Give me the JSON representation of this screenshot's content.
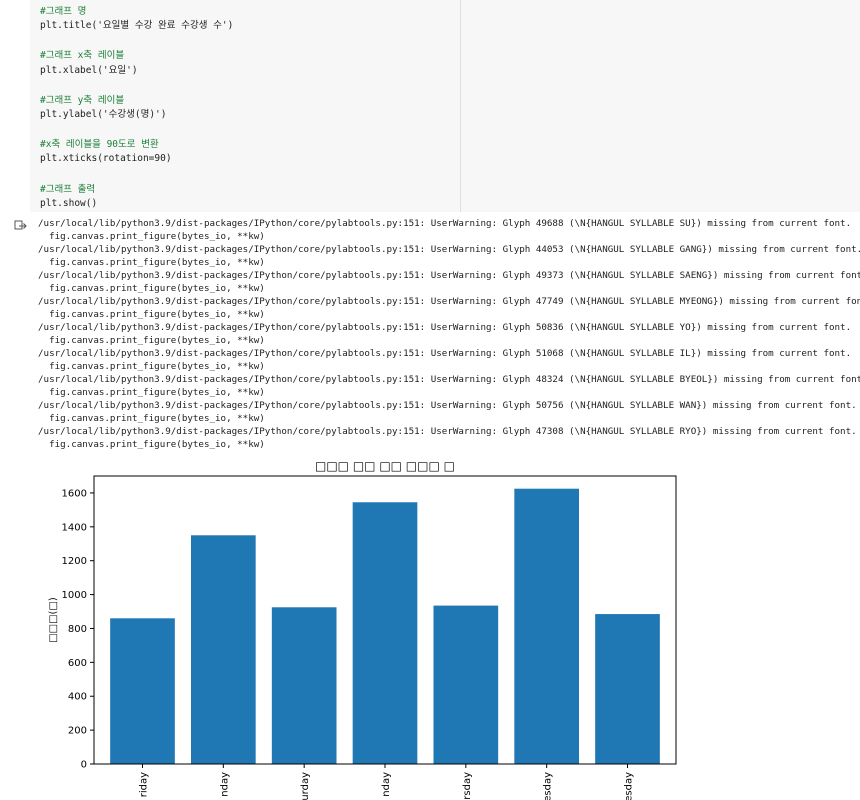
{
  "code_cell": {
    "lines": [
      {
        "kind": "comment",
        "text": "#그래프 명"
      },
      {
        "kind": "code",
        "text": "plt.title('요일별 수강 완료 수강생 수')"
      },
      {
        "kind": "blank",
        "text": ""
      },
      {
        "kind": "comment",
        "text": "#그래프 x축 레이블"
      },
      {
        "kind": "code",
        "text": "plt.xlabel('요일')"
      },
      {
        "kind": "blank",
        "text": ""
      },
      {
        "kind": "comment",
        "text": "#그래프 y축 레이블"
      },
      {
        "kind": "code",
        "text": "plt.ylabel('수강생(명)')"
      },
      {
        "kind": "blank",
        "text": ""
      },
      {
        "kind": "comment",
        "text": "#x축 레이블을 90도로 변환"
      },
      {
        "kind": "code",
        "text": "plt.xticks(rotation=90)"
      },
      {
        "kind": "blank",
        "text": ""
      },
      {
        "kind": "comment",
        "text": "#그래프 출력"
      },
      {
        "kind": "code",
        "text": "plt.show()"
      }
    ]
  },
  "output": {
    "icon": "output-arrow-icon",
    "warnings": [
      "/usr/local/lib/python3.9/dist-packages/IPython/core/pylabtools.py:151: UserWarning: Glyph 49688 (\\N{HANGUL SYLLABLE SU}) missing from current font.",
      "  fig.canvas.print_figure(bytes_io, **kw)",
      "/usr/local/lib/python3.9/dist-packages/IPython/core/pylabtools.py:151: UserWarning: Glyph 44053 (\\N{HANGUL SYLLABLE GANG}) missing from current font.",
      "  fig.canvas.print_figure(bytes_io, **kw)",
      "/usr/local/lib/python3.9/dist-packages/IPython/core/pylabtools.py:151: UserWarning: Glyph 49373 (\\N{HANGUL SYLLABLE SAENG}) missing from current font.",
      "  fig.canvas.print_figure(bytes_io, **kw)",
      "/usr/local/lib/python3.9/dist-packages/IPython/core/pylabtools.py:151: UserWarning: Glyph 47749 (\\N{HANGUL SYLLABLE MYEONG}) missing from current font.",
      "  fig.canvas.print_figure(bytes_io, **kw)",
      "/usr/local/lib/python3.9/dist-packages/IPython/core/pylabtools.py:151: UserWarning: Glyph 50836 (\\N{HANGUL SYLLABLE YO}) missing from current font.",
      "  fig.canvas.print_figure(bytes_io, **kw)",
      "/usr/local/lib/python3.9/dist-packages/IPython/core/pylabtools.py:151: UserWarning: Glyph 51068 (\\N{HANGUL SYLLABLE IL}) missing from current font.",
      "  fig.canvas.print_figure(bytes_io, **kw)",
      "/usr/local/lib/python3.9/dist-packages/IPython/core/pylabtools.py:151: UserWarning: Glyph 48324 (\\N{HANGUL SYLLABLE BYEOL}) missing from current font.",
      "  fig.canvas.print_figure(bytes_io, **kw)",
      "/usr/local/lib/python3.9/dist-packages/IPython/core/pylabtools.py:151: UserWarning: Glyph 50756 (\\N{HANGUL SYLLABLE WAN}) missing from current font.",
      "  fig.canvas.print_figure(bytes_io, **kw)",
      "/usr/local/lib/python3.9/dist-packages/IPython/core/pylabtools.py:151: UserWarning: Glyph 47308 (\\N{HANGUL SYLLABLE RYO}) missing from current font.",
      "  fig.canvas.print_figure(bytes_io, **kw)"
    ]
  },
  "colors": {
    "bar": "#1f77b4",
    "comment": "#1a7f37",
    "string": "#a31515"
  },
  "chart_data": {
    "type": "bar",
    "title": "□□□ □□ □□ □□□ □",
    "xlabel": "",
    "ylabel": "□□□(□)",
    "categories": [
      "riday",
      "nday",
      "urday",
      "nday",
      "rsday",
      "esday",
      "esday"
    ],
    "values": [
      860,
      1350,
      925,
      1545,
      935,
      1625,
      885
    ],
    "ylim": [
      0,
      1700
    ],
    "yticks": [
      0,
      200,
      400,
      600,
      800,
      1000,
      1200,
      1400,
      1600
    ],
    "grid": false
  }
}
